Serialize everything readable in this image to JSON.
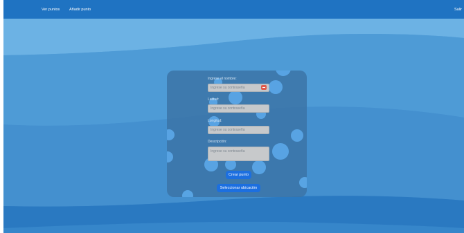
{
  "nav": {
    "ver_puntos": "Ver puntos",
    "anadir_punto": "Añadir punto",
    "salir": "Salir"
  },
  "form": {
    "nombre_label": "Ingrese el nombre:",
    "latitud_label": "Latitud:",
    "longitud_label": "Longitud:",
    "descripcion_label": "Descripción:",
    "nombre_placeholder": "Ingrese su contraseña",
    "latitud_placeholder": "Ingrese su contraseña",
    "longitud_placeholder": "Ingrese su contraseña",
    "descripcion_placeholder": "Ingrese su contraseña",
    "crear_button": "Crear punto",
    "seleccionar_button": "Seleccionar ubicación"
  },
  "colors": {
    "navbar": "#1f73c2",
    "button": "#1c6fe0",
    "password_icon": "#e05a4a"
  }
}
